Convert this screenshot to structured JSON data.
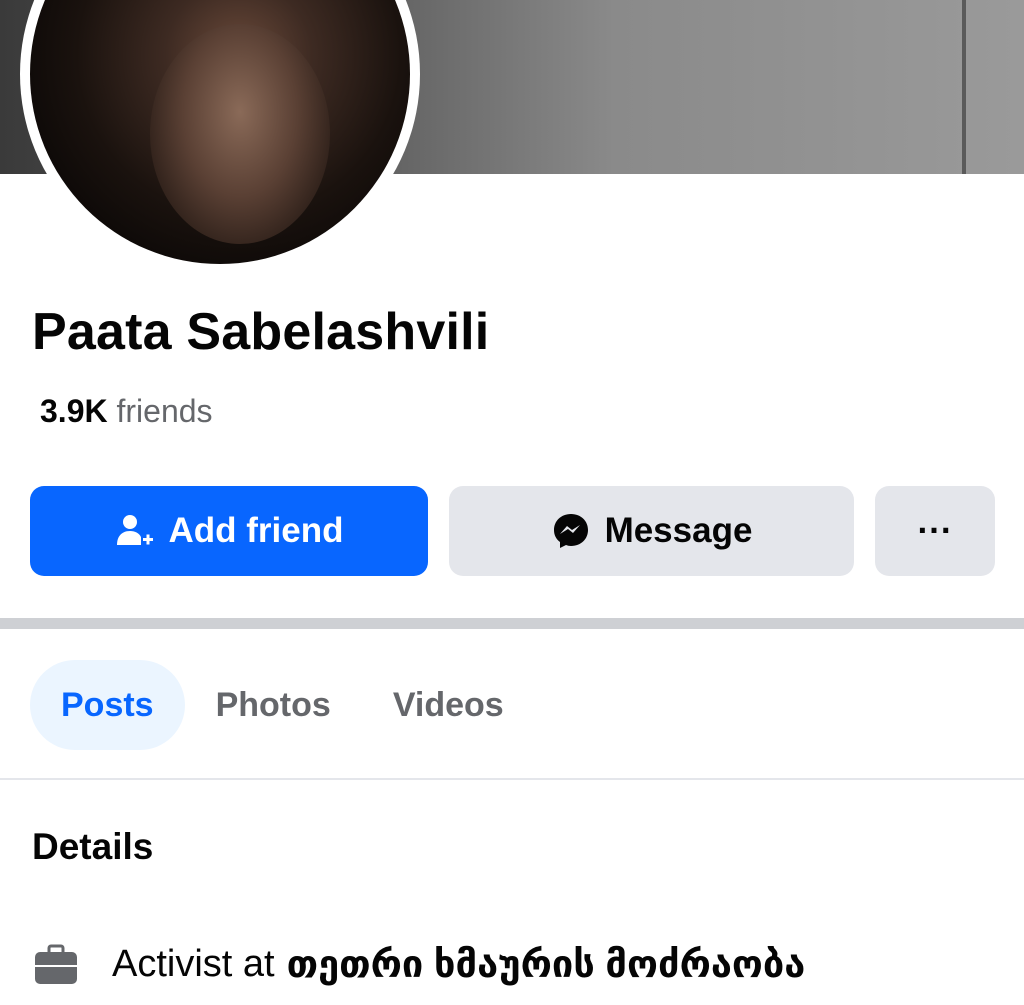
{
  "profile": {
    "name": "Paata Sabelashvili",
    "friends_count": "3.9K",
    "friends_label": "friends"
  },
  "actions": {
    "add_friend_label": "Add friend",
    "message_label": "Message",
    "more_label": "···"
  },
  "tabs": [
    {
      "label": "Posts",
      "active": true
    },
    {
      "label": "Photos",
      "active": false
    },
    {
      "label": "Videos",
      "active": false
    }
  ],
  "details": {
    "title": "Details",
    "work_prefix": "Activist at",
    "work_org": "თეთრი ხმაურის მოძრაობა"
  },
  "icons": {
    "add_friend": "person-add-icon",
    "message": "messenger-icon",
    "more": "more-dots-icon",
    "work": "briefcase-icon"
  },
  "colors": {
    "primary": "#0866ff",
    "secondary_button": "#e4e6eb",
    "tab_active_bg": "#ebf5ff",
    "muted_text": "#65676b"
  }
}
